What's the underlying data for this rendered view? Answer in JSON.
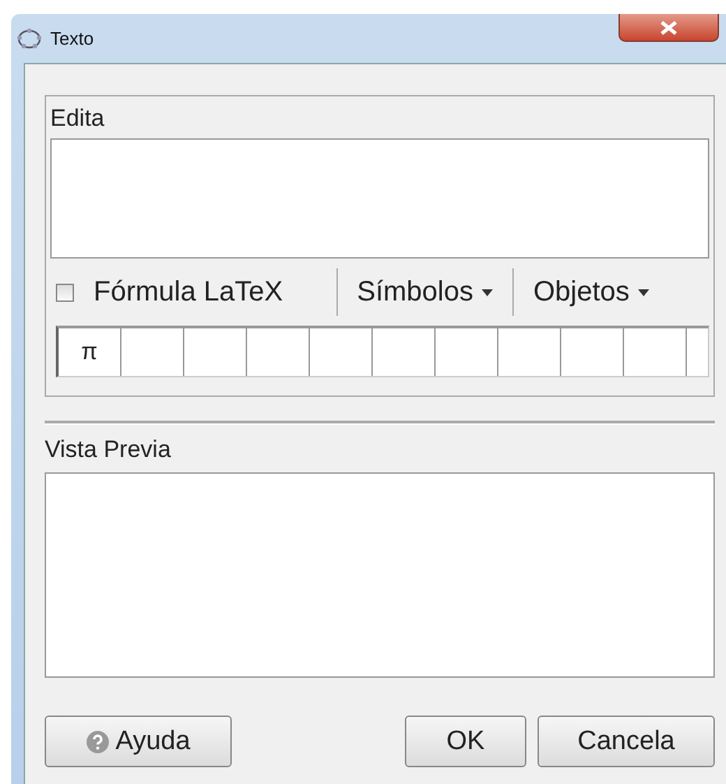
{
  "window": {
    "title": "Texto"
  },
  "edit_panel": {
    "title": "Edita",
    "latex_checkbox": {
      "label": "Fórmula LaTeX",
      "checked": false
    },
    "menus": [
      "Símbolos",
      "Objetos"
    ],
    "symbols": [
      "π"
    ]
  },
  "preview_panel": {
    "title": "Vista Previa"
  },
  "buttons": {
    "help": "Ayuda",
    "ok": "OK",
    "cancel": "Cancela"
  }
}
